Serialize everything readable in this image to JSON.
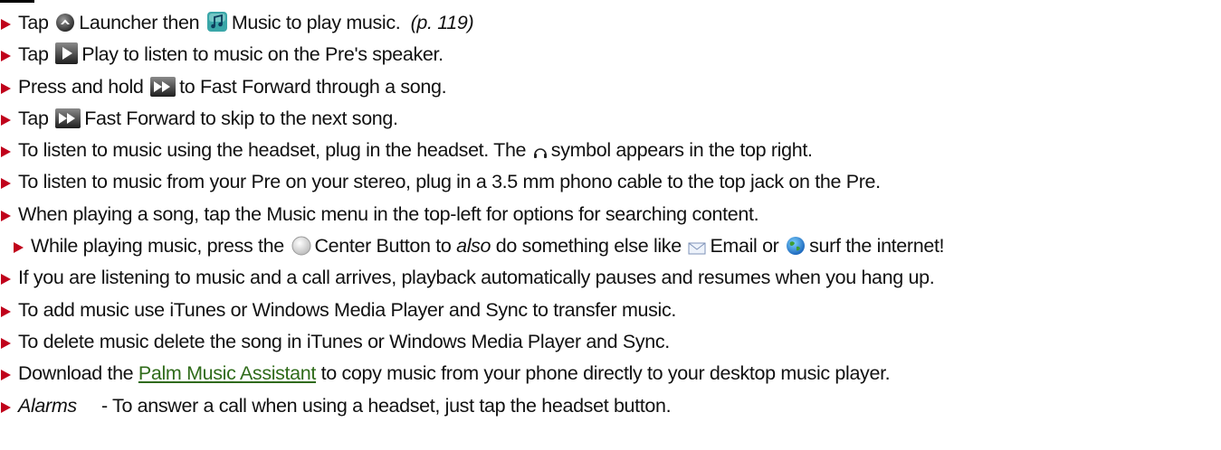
{
  "rows": [
    {
      "parts": [
        "Tap",
        "Launcher then",
        "Music to play music.",
        "(p. 119)"
      ]
    },
    {
      "parts": [
        "Tap",
        "Play to listen to music on the Pre's speaker."
      ]
    },
    {
      "parts": [
        "Press and hold",
        "to Fast Forward through a song."
      ]
    },
    {
      "parts": [
        "Tap",
        "Fast Forward to skip to the next song."
      ]
    },
    {
      "parts": [
        "To listen to music using the headset, plug in the headset. The",
        "symbol appears in the top right."
      ]
    },
    {
      "parts": [
        "To listen to music from your Pre on your stereo, plug in a 3.5 mm phono cable to the top jack on the Pre."
      ]
    },
    {
      "parts": [
        "When playing a song, tap the Music menu in the top-left for options for searching content."
      ]
    },
    {
      "parts": [
        "While playing music, press the",
        "Center Button to",
        "also",
        "do something else like",
        "Email or",
        "surf the internet!"
      ]
    },
    {
      "parts": [
        "If you are listening to music and a call arrives, playback automatically pauses and resumes when you hang up."
      ]
    },
    {
      "parts": [
        "To add music use iTunes or Windows Media Player and Sync to transfer music."
      ]
    },
    {
      "parts": [
        "To delete music delete the song in iTunes or Windows Media Player and Sync."
      ]
    },
    {
      "parts": [
        "Download the",
        "Palm Music Assistant",
        "to copy music from your phone directly to your desktop music player."
      ]
    },
    {
      "parts": [
        "Alarms",
        "- To answer a call when using a headset, just tap the headset button."
      ]
    }
  ],
  "colors": {
    "bullet": "#c0021b",
    "link": "#2f6b1a"
  },
  "icons": [
    "launcher-icon",
    "music-app-icon",
    "play-icon",
    "fast-forward-icon",
    "headphones-icon",
    "center-button-icon",
    "email-icon",
    "web-globe-icon"
  ]
}
